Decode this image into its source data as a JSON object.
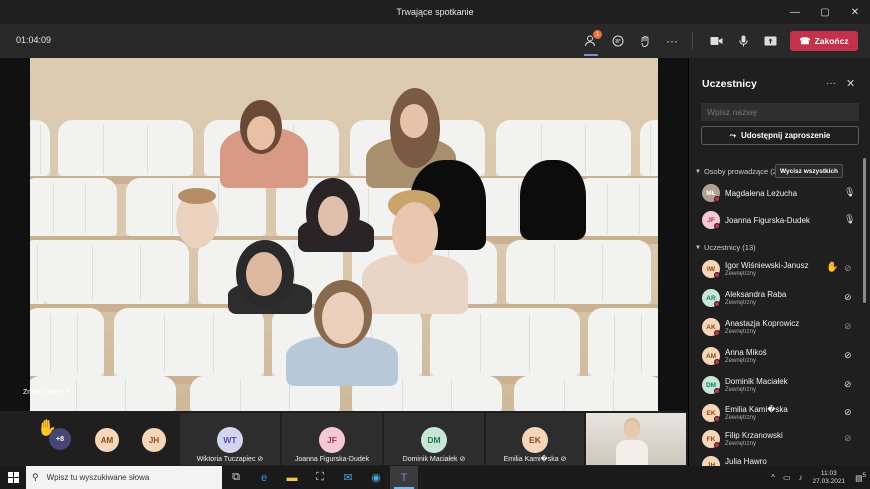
{
  "window": {
    "title": "Trwające spotkanie",
    "controls": [
      "—",
      "▢",
      "✕"
    ]
  },
  "toolbar": {
    "timer": "01:04:09",
    "participants_badge": "1",
    "leave_label": "Zakończ"
  },
  "stage": {
    "change_scene_label": "Zmień scenę"
  },
  "strip": {
    "more_count": "+8",
    "small_avatars": [
      {
        "initials": "AM",
        "bg": "#f6d6b8",
        "fg": "#8a4a1a"
      },
      {
        "initials": "JH",
        "bg": "#f6d6b8",
        "fg": "#8a4a1a"
      }
    ],
    "tiles": [
      {
        "initials": "WT",
        "name": "Wiktoria Tuczapiec",
        "bg": "#d3d4f0",
        "fg": "#4f52b2"
      },
      {
        "initials": "JF",
        "name": "Joanna Figurska-Dudek",
        "bg": "#f4c9d4",
        "fg": "#b0344f"
      },
      {
        "initials": "DM",
        "name": "Dominik Maciałek",
        "bg": "#c6e6d8",
        "fg": "#237a54"
      },
      {
        "initials": "EK",
        "name": "Emilia Kami�ska",
        "bg": "#f6d6b8",
        "fg": "#8a4a1a"
      }
    ]
  },
  "panel": {
    "title": "Uczestnicy",
    "search_placeholder": "Wpisz nazwę",
    "share_label": "Udostępnij zaproszenie",
    "presenters_header": "Osoby prowadzące (2)",
    "mute_all_label": "Wycisz wszystkich",
    "attendees_header": "Uczestnicy (13)",
    "presenters": [
      {
        "initials": "MŁ",
        "name": "Magdalena Leżucha",
        "bg": "#b0a090",
        "fg": "#fff",
        "mic": "on"
      },
      {
        "initials": "JF",
        "name": "Joanna Figurska-Dudek",
        "bg": "#f4c9d4",
        "fg": "#b0344f",
        "mic": "on"
      }
    ],
    "attendees": [
      {
        "initials": "IW",
        "name": "Igor Wiśniewski-Janusz",
        "sub": "Zewnętrzny",
        "bg": "#f6d6b8",
        "fg": "#8a4a1a",
        "hand": true
      },
      {
        "initials": "AR",
        "name": "Aleksandra Raba",
        "sub": "Zewnętrzny",
        "bg": "#c6e6d8",
        "fg": "#237a54"
      },
      {
        "initials": "AK",
        "name": "Anastazja Koprowicz",
        "sub": "Zewnętrzny",
        "bg": "#f6d6b8",
        "fg": "#8a4a1a"
      },
      {
        "initials": "AM",
        "name": "Anna Mikoś",
        "sub": "Zewnętrzny",
        "bg": "#f6d6b8",
        "fg": "#8a4a1a"
      },
      {
        "initials": "DM",
        "name": "Dominik Maciałek",
        "sub": "Zewnętrzny",
        "bg": "#c6e6d8",
        "fg": "#237a54"
      },
      {
        "initials": "EK",
        "name": "Emilia Kami�ska",
        "sub": "Zewnętrzny",
        "bg": "#f6d6b8",
        "fg": "#8a4a1a"
      },
      {
        "initials": "FK",
        "name": "Filip Krzanowski",
        "sub": "Zewnętrzny",
        "bg": "#f6d6b8",
        "fg": "#8a4a1a"
      },
      {
        "initials": "JH",
        "name": "Julia Hawro",
        "sub": "",
        "bg": "#f6d6b8",
        "fg": "#8a4a1a"
      }
    ]
  },
  "taskbar": {
    "search_placeholder": "Wpisz tu wyszukiwane słowa",
    "time": "11:03",
    "date": "27.03.2021",
    "notif_count": "5"
  },
  "colors": {
    "leave": "#c4314b",
    "accent": "#8b8cc7",
    "badge": "#e8703a"
  }
}
